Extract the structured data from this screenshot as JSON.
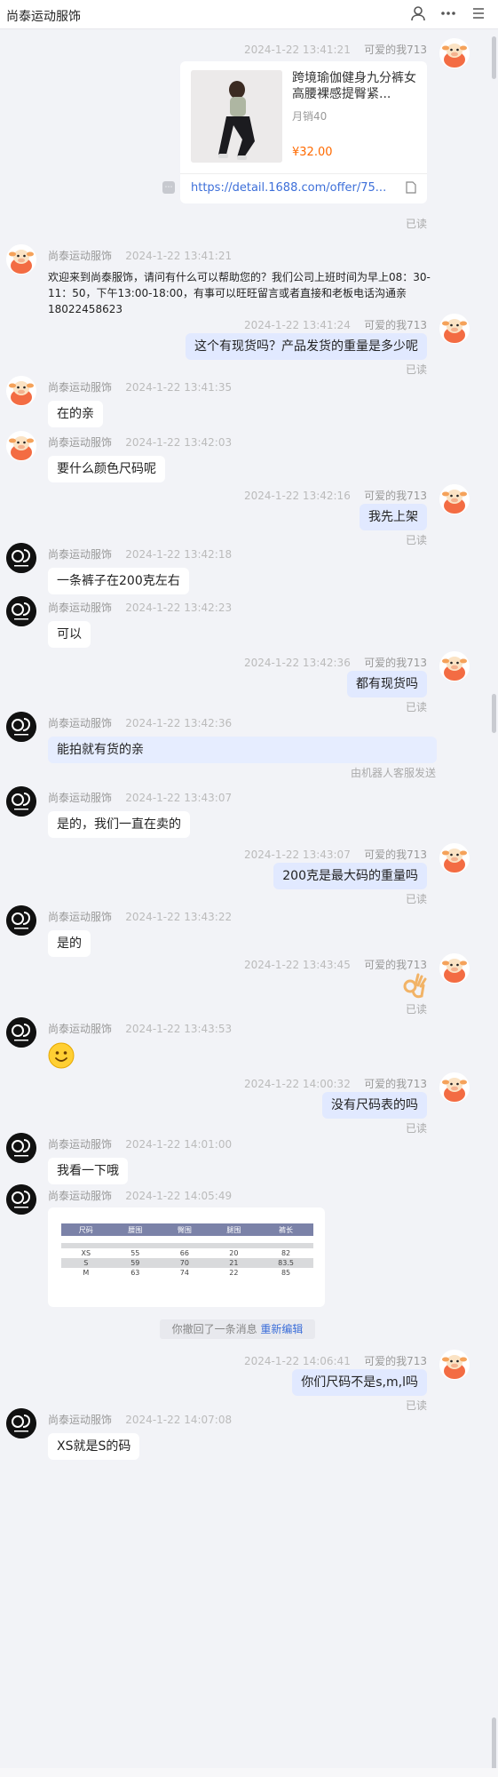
{
  "header": {
    "title": "尚泰运动服饰",
    "icons": [
      "user-icon",
      "more-icon",
      "menu-icon"
    ]
  },
  "names": {
    "shop": "尚泰运动服饰",
    "me": "可爱的我713"
  },
  "status": {
    "read": "已读",
    "bot_note": "由机器人客服发送"
  },
  "product_card": {
    "title": "跨境瑜伽健身九分裤女高腰裸感提臀紧...",
    "sales": "月销40",
    "price": "¥32.00",
    "link": "https://detail.1688.com/offer/75..."
  },
  "messages": [
    {
      "id": "m1",
      "dir": "out",
      "time": "2024-1-22 13:41:21",
      "type": "card",
      "read": true
    },
    {
      "id": "m2",
      "dir": "in",
      "avatar": "cow",
      "time": "2024-1-22 13:41:21",
      "type": "welcome",
      "text": "欢迎来到尚泰服饰，请问有什么可以帮助您的？我们公司上班时间为早上08：30-11：50，下午13:00-18:00，有事可以旺旺留言或者直接和老板电话沟通亲18022458623"
    },
    {
      "id": "m3",
      "dir": "out",
      "time": "2024-1-22 13:41:24",
      "text": "这个有现货吗？产品发货的重量是多少呢",
      "read": true
    },
    {
      "id": "m4",
      "dir": "in",
      "avatar": "cow",
      "time": "2024-1-22 13:41:35",
      "text": "在的亲"
    },
    {
      "id": "m5",
      "dir": "in",
      "avatar": "cow",
      "time": "2024-1-22 13:42:03",
      "text": "要什么颜色尺码呢"
    },
    {
      "id": "m6",
      "dir": "out",
      "time": "2024-1-22 13:42:16",
      "text": "我先上架",
      "read": true
    },
    {
      "id": "m7",
      "dir": "in",
      "avatar": "logo",
      "time": "2024-1-22 13:42:18",
      "text": "一条裤子在200克左右"
    },
    {
      "id": "m8",
      "dir": "in",
      "avatar": "logo",
      "time": "2024-1-22 13:42:23",
      "text": "可以"
    },
    {
      "id": "m9",
      "dir": "out",
      "time": "2024-1-22 13:42:36",
      "text": "都有现货吗",
      "read": true
    },
    {
      "id": "m10",
      "dir": "in",
      "avatar": "logo",
      "time": "2024-1-22 13:42:36",
      "text": "能拍就有货的亲",
      "bot": true
    },
    {
      "id": "m11",
      "dir": "in",
      "avatar": "logo",
      "time": "2024-1-22 13:43:07",
      "text": "是的，我们一直在卖的"
    },
    {
      "id": "m12",
      "dir": "out",
      "time": "2024-1-22 13:43:07",
      "text": "200克是最大码的重量吗",
      "read": true
    },
    {
      "id": "m13",
      "dir": "in",
      "avatar": "logo",
      "time": "2024-1-22 13:43:22",
      "text": "是的"
    },
    {
      "id": "m14",
      "dir": "out",
      "time": "2024-1-22 13:43:45",
      "type": "emoji",
      "emoji": "ok-hand",
      "read": true
    },
    {
      "id": "m15",
      "dir": "in",
      "avatar": "logo",
      "time": "2024-1-22 13:43:53",
      "type": "emoji",
      "emoji": "smile"
    },
    {
      "id": "m16",
      "dir": "out",
      "time": "2024-1-22 14:00:32",
      "text": "没有尺码表的吗",
      "read": true
    },
    {
      "id": "m17",
      "dir": "in",
      "avatar": "logo",
      "time": "2024-1-22 14:01:00",
      "text": "我看一下哦"
    },
    {
      "id": "m18",
      "dir": "in",
      "avatar": "logo",
      "time": "2024-1-22 14:05:49",
      "type": "image"
    },
    {
      "id": "m19",
      "dir": "out",
      "time": "2024-1-22 14:06:41",
      "text": "你们尺码不是s,m,l吗",
      "read": true
    },
    {
      "id": "m20",
      "dir": "in",
      "avatar": "logo",
      "time": "2024-1-22 14:07:08",
      "text": "XS就是S的码"
    }
  ],
  "size_table": {
    "headers": [
      "尺码",
      "腰围",
      "臀围",
      "腿围",
      "裤长"
    ],
    "rows": [
      [
        "XS",
        "55",
        "66",
        "20",
        "82"
      ],
      [
        "S",
        "59",
        "70",
        "21",
        "83.5"
      ],
      [
        "M",
        "63",
        "74",
        "22",
        "85"
      ]
    ]
  },
  "recall": {
    "text": "你撤回了一条消息",
    "edit": "重新编辑"
  },
  "colors": {
    "accent": "#3d6fd9",
    "price": "#ff6a00",
    "out_bubble": "#e1e9ff"
  }
}
